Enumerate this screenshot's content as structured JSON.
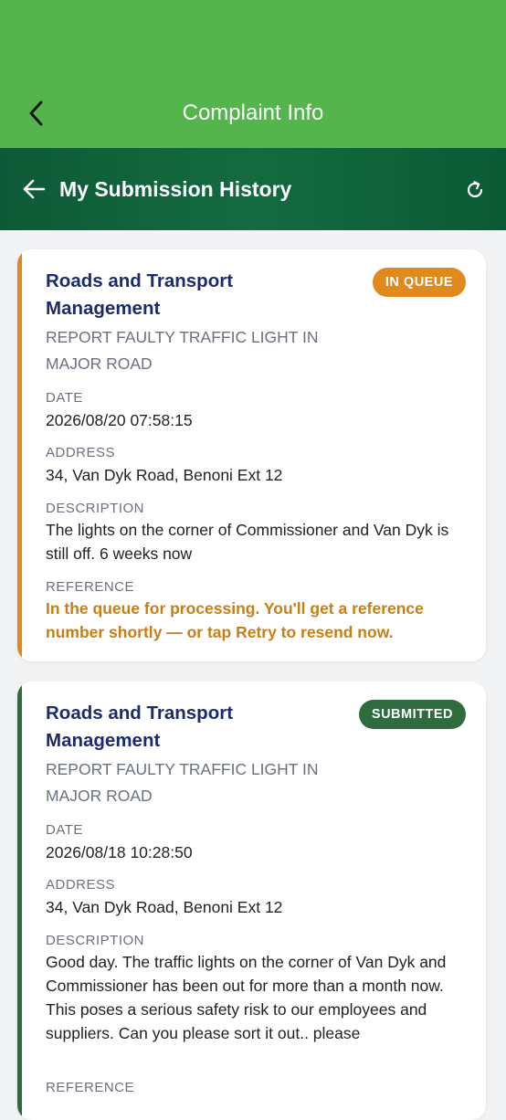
{
  "app_bar": {
    "title": "Complaint Info"
  },
  "header": {
    "title": "My Submission History"
  },
  "submissions": [
    {
      "department": "Roads and Transport Management",
      "status": "IN QUEUE",
      "subject": "REPORT FAULTY TRAFFIC LIGHT IN MAJOR ROAD",
      "date_label": "DATE",
      "date": "2026/08/20 07:58:15",
      "address_label": "ADDRESS",
      "address": "34, Van Dyk Road, Benoni Ext 12",
      "description_label": "DESCRIPTION",
      "description": "The lights on the corner of Commissioner and Van Dyk is still off. 6 weeks now",
      "reference_label": "REFERENCE",
      "reference": "In the queue for processing. You'll get a reference number shortly — or tap Retry to resend now."
    },
    {
      "department": "Roads and Transport Management",
      "status": "SUBMITTED",
      "subject": "REPORT FAULTY TRAFFIC LIGHT IN MAJOR ROAD",
      "date_label": "DATE",
      "date": "2026/08/18 10:28:50",
      "address_label": "ADDRESS",
      "address": "34, Van Dyk Road, Benoni Ext 12",
      "description_label": "DESCRIPTION",
      "description": "Good day. The traffic lights on the corner of Van Dyk and Commissioner has been out for more than a month now. This poses a serious safety risk to our employees and suppliers. Can you please sort it out.. please",
      "reference_label": "REFERENCE"
    }
  ],
  "icons": {
    "app_back": "chevron-left-icon",
    "header_back": "arrow-left-icon",
    "refresh": "refresh-icon"
  },
  "colors": {
    "app_bar": "#54b54d",
    "header": "#0d5a37",
    "in_queue": "#e08a1e",
    "submitted": "#2e6b3e",
    "department_text": "#1c2a6e"
  }
}
